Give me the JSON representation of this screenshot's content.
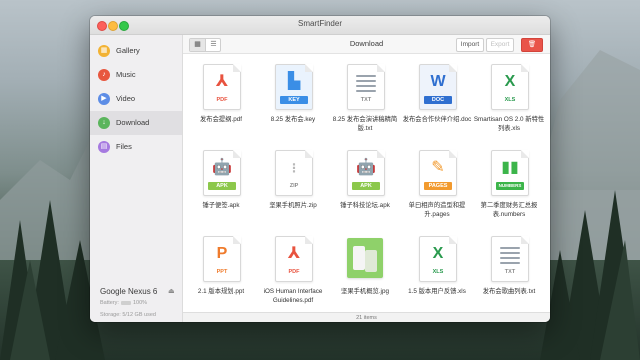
{
  "app": {
    "title": "SmartFinder"
  },
  "sidebar": {
    "items": [
      {
        "label": "Gallery",
        "icon": "gallery-icon",
        "color": "#f2b233"
      },
      {
        "label": "Music",
        "icon": "music-icon",
        "color": "#e8573f"
      },
      {
        "label": "Video",
        "icon": "video-icon",
        "color": "#5d8de6"
      },
      {
        "label": "Download",
        "icon": "download-icon",
        "color": "#5bb55d"
      },
      {
        "label": "Files",
        "icon": "files-icon",
        "color": "#a67ae0"
      }
    ],
    "active_index": 3,
    "device": {
      "name": "Google Nexus 6",
      "battery_label": "Battery:",
      "battery_value": "100%",
      "storage": "Storage: 5/12 GB used"
    }
  },
  "toolbar": {
    "title": "Download",
    "import_label": "Import",
    "export_label": "Export",
    "grid_icon": "grid-view-icon",
    "list_icon": "list-view-icon",
    "delete_icon": "trash-icon"
  },
  "files": [
    {
      "name": "发布会提纲.pdf",
      "type": "PDF",
      "color": "#e8533f",
      "icon": "pdf-icon"
    },
    {
      "name": "8.25 发布会.key",
      "type": "KEY",
      "color": "#3a8ee6",
      "icon": "keynote-icon"
    },
    {
      "name": "8.25 发布会演讲稿精简版.txt",
      "type": "TXT",
      "color": "#9aa3ad",
      "icon": "text-icon"
    },
    {
      "name": "发布会合作伙伴介绍.doc",
      "type": "DOC",
      "color": "#2f6fd0",
      "icon": "word-icon"
    },
    {
      "name": "Smartisan OS 2.0 新特性列表.xls",
      "type": "XLS",
      "color": "#2a9a4e",
      "icon": "excel-icon"
    },
    {
      "name": "锤子便签.apk",
      "type": "APK",
      "color": "#8cc84b",
      "icon": "android-icon"
    },
    {
      "name": "坚果手机照片.zip",
      "type": "ZIP",
      "color": "#b9b9b9",
      "icon": "zip-icon"
    },
    {
      "name": "锤子科技论坛.apk",
      "type": "APK",
      "color": "#8cc84b",
      "icon": "android-icon"
    },
    {
      "name": "单曰相声的造型和提升.pages",
      "type": "PAGES",
      "color": "#f29a2e",
      "icon": "pages-icon"
    },
    {
      "name": "第二季度财务汇总报表.numbers",
      "type": "NUMBERS",
      "color": "#3cb54a",
      "icon": "numbers-icon"
    },
    {
      "name": "2.1 版本规划.ppt",
      "type": "PPT",
      "color": "#ef7b2c",
      "icon": "powerpoint-icon"
    },
    {
      "name": "iOS Human Interface Guidelines.pdf",
      "type": "PDF",
      "color": "#e8533f",
      "icon": "pdf-icon"
    },
    {
      "name": "坚果手机概览.jpg",
      "type": "JPG",
      "color": "#8fd16a",
      "icon": "image-thumbnail"
    },
    {
      "name": "1.5 版本用户反馈.xls",
      "type": "XLS",
      "color": "#2a9a4e",
      "icon": "excel-icon"
    },
    {
      "name": "发布会歌曲列表.txt",
      "type": "TXT",
      "color": "#9aa3ad",
      "icon": "text-icon"
    }
  ],
  "status": {
    "items_count": "21 items"
  }
}
